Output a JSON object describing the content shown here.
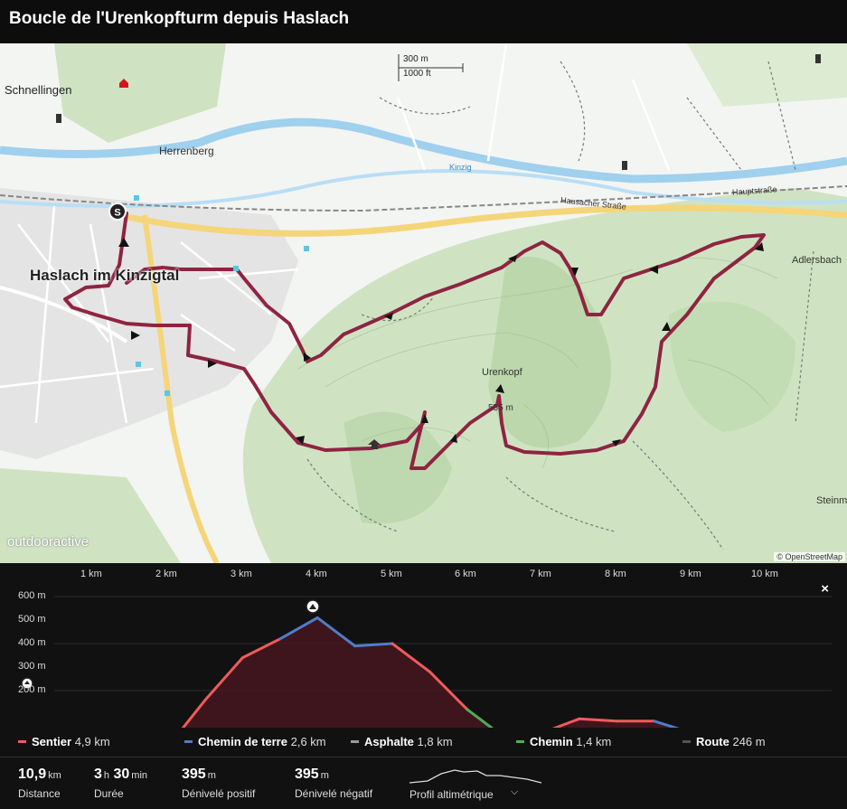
{
  "header": {
    "title": "Boucle de l'Urenkopfturm depuis Haslach"
  },
  "map": {
    "labels": {
      "schnellingen": "Schnellingen",
      "herrenberg": "Herrenberg",
      "haslach": "Haslach im Kinzigtal",
      "urenkopf": "Urenkopf",
      "summit": "555 m",
      "adlersbach": "Adlersbach",
      "steinma": "Steinma",
      "kinzig": "Kinzig",
      "hausacher": "Hausacher Straße",
      "hauptstrasse": "Hauptstraße"
    },
    "scale": {
      "metric": "300 m",
      "imperial": "1000 ft"
    },
    "watermark": "outdooractive",
    "attribution": "© OpenStreetMap",
    "colors": {
      "route": "#8e2442",
      "forest": "#cfe3c2",
      "river": "#9fd0ee",
      "road": "#f5d57a"
    }
  },
  "profile": {
    "km_ticks": [
      "1 km",
      "2 km",
      "3 km",
      "4 km",
      "5 km",
      "6 km",
      "7 km",
      "8 km",
      "9 km",
      "10 km"
    ],
    "alt_ticks": [
      "600 m",
      "500 m",
      "400 m",
      "300 m",
      "200 m"
    ],
    "close_label": "×",
    "elevation_km": [
      0,
      0.5,
      1,
      1.5,
      2,
      2.5,
      3,
      3.5,
      4,
      4.5,
      5,
      5.5,
      6,
      6.5,
      7,
      7.5,
      8,
      8.5,
      9,
      9.5,
      10,
      10.5,
      10.9
    ],
    "elevation_m": [
      195,
      195,
      200,
      210,
      280,
      380,
      470,
      510,
      555,
      495,
      500,
      440,
      360,
      300,
      310,
      340,
      335,
      335,
      310,
      230,
      190,
      190,
      190
    ]
  },
  "legend": [
    {
      "name": "Sentier",
      "value": "4,9 km",
      "color": "#ef5b5b"
    },
    {
      "name": "Chemin de terre",
      "value": "2,6 km",
      "color": "#4f7dc8"
    },
    {
      "name": "Asphalte",
      "value": "1,8 km",
      "color": "#9a9a9a"
    },
    {
      "name": "Chemin",
      "value": "1,4 km",
      "color": "#4caf50"
    },
    {
      "name": "Route",
      "value": "246 m",
      "color": "#555555"
    }
  ],
  "stats": {
    "distance": {
      "value": "10,9",
      "unit": "km",
      "caption": "Distance"
    },
    "duration": {
      "hours": "3",
      "h_unit": "h",
      "minutes": "30",
      "m_unit": "min",
      "caption": "Durée"
    },
    "ascent": {
      "value": "395",
      "unit": "m",
      "caption": "Dénivelé positif"
    },
    "descent": {
      "value": "395",
      "unit": "m",
      "caption": "Dénivelé négatif"
    },
    "profile_toggle": "Profil altimétrique"
  }
}
